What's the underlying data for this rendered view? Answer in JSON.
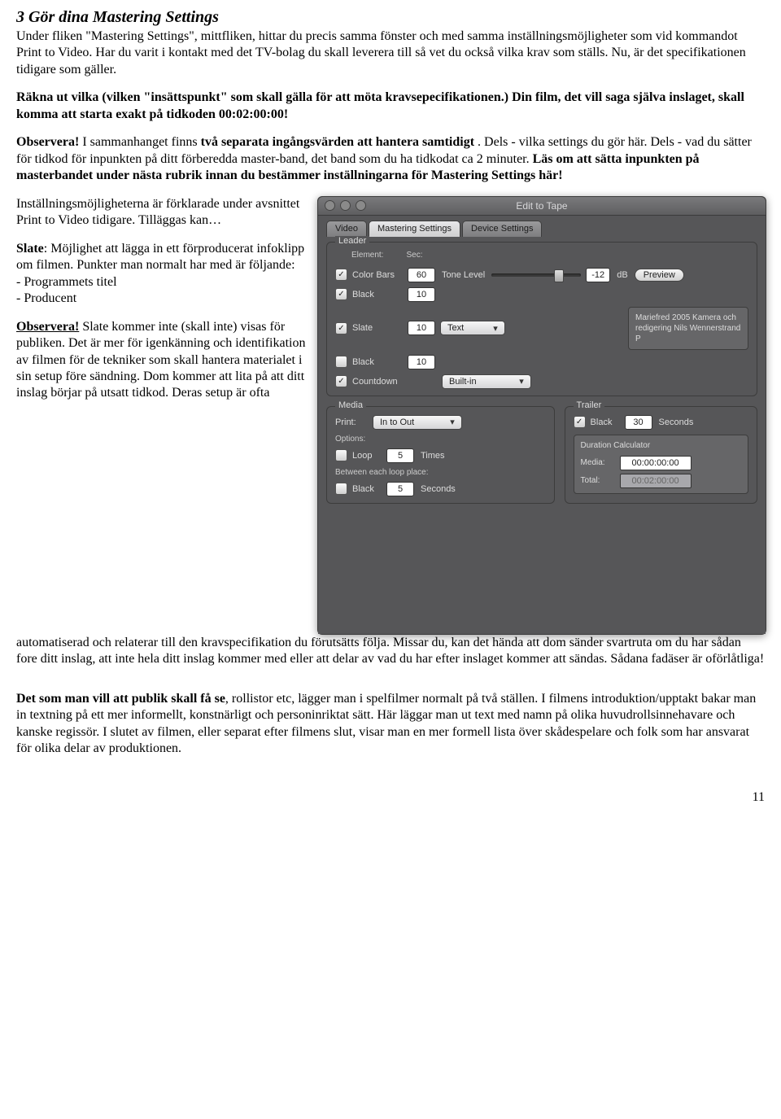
{
  "heading": "3 Gör dina Mastering Settings",
  "p1": "Under fliken \"Mastering Settings\", mittfliken, hittar du precis samma fönster och med samma inställningsmöjligheter som vid kommandot Print to Video. Har du varit i kontakt med det TV-bolag du skall leverera till så vet du också vilka krav som ställs. Nu, är det specifikationen tidigare som gäller.",
  "p2": "Räkna ut vilka (vilken \"insättspunkt\" som skall gälla för att möta kravsepecifikationen.) Din film, det vill saga själva inslaget, skall komma att starta exakt på tidkoden 00:02:00:00!",
  "p3_strong1": "Observera!",
  "p3_mid1": " I sammanhanget finns ",
  "p3_strong2": "två separata ingångsvärden att hantera samtidigt",
  "p3_mid2": ". Dels - vilka settings du gör här. Dels - vad du sätter för tidkod för inpunkten på ditt förberedda master-band, det band som du ha tidkodat ca 2 minuter. ",
  "p3_strong3": "Läs om att sätta inpunkten på masterbandet under nästa rubrik innan du bestämmer inställningarna för Mastering Settings här!",
  "left1": "Inställningsmöjligheterna är förklarade under avsnittet Print to Video tidigare. Tilläggas kan…",
  "left_slate_label": "Slate",
  "left_slate_rest": ": Möjlighet att lägga in ett förproducerat infoklipp om filmen. Punkter man normalt har med är följande:",
  "left_bullet1": "- Programmets titel",
  "left_bullet2": "- Producent",
  "left_obs": "Observera!",
  "left_obs_rest": " Slate kommer inte (skall inte) visas för publiken. Det är mer för igenkänning och identifikation av filmen för de tekniker som skall hantera materialet i sin setup före sändning. Dom kommer att lita på att ditt inslag börjar på utsatt tidkod. Deras setup är ofta",
  "p_after": "automatiserad och relaterar till den kravspecifikation du förutsätts följa. Missar du, kan det hända att dom sänder svartruta om du har sådan fore ditt inslag, att inte hela ditt inslag kommer med eller att delar av vad du har efter inslaget kommer att sändas. Sådana fadäser är oförlåtliga!",
  "p_last_strong": "Det som man vill att publik skall få se",
  "p_last": ", rollistor etc, lägger man i spelfilmer normalt på två ställen. I filmens introduktion/upptakt bakar man in textning på ett mer informellt, konstnärligt och personinriktat sätt. Här läggar man ut text med namn på olika huvudrollsinnehavare och kanske regissör. I slutet av filmen, eller separat efter filmens slut, visar man en mer formell lista över skådespelare och folk som har ansvarat för olika delar av produktionen.",
  "pagenum": "11",
  "ui": {
    "window_title": "Edit to Tape",
    "tabs": [
      "Video",
      "Mastering Settings",
      "Device Settings"
    ],
    "leader": {
      "legend": "Leader",
      "col_element": "Element:",
      "col_sec": "Sec:",
      "color_bars": {
        "label": "Color Bars",
        "sec": "60",
        "tone_label": "Tone Level",
        "db_val": "-12",
        "db_unit": "dB",
        "preview": "Preview"
      },
      "black1": {
        "label": "Black",
        "sec": "10"
      },
      "slate": {
        "label": "Slate",
        "sec": "10",
        "source": "Text",
        "note": "Mariefred 2005\nKamera och redigering\nNils Wennerstrand P"
      },
      "black2": {
        "label": "Black",
        "sec": "10"
      },
      "countdown": {
        "label": "Countdown",
        "source": "Built-in"
      }
    },
    "media": {
      "legend": "Media",
      "print_label": "Print:",
      "print_value": "In to Out",
      "options_label": "Options:",
      "loop_label": "Loop",
      "loop_val": "5",
      "loop_unit": "Times",
      "between_label": "Between each loop place:",
      "black_label": "Black",
      "black_val": "5",
      "black_unit": "Seconds"
    },
    "trailer": {
      "legend": "Trailer",
      "black_label": "Black",
      "black_val": "30",
      "black_unit": "Seconds",
      "dc_label": "Duration Calculator",
      "media_label": "Media:",
      "media_val": "00:00:00:00",
      "total_label": "Total:",
      "total_val": "00:02:00:00"
    }
  }
}
